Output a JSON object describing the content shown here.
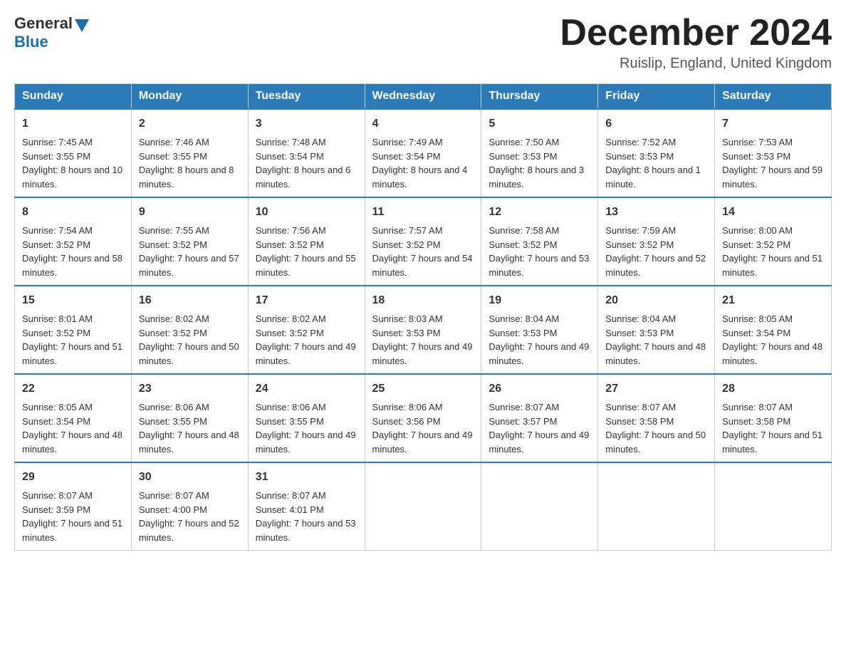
{
  "header": {
    "logo_general": "General",
    "logo_blue": "Blue",
    "month_title": "December 2024",
    "location": "Ruislip, England, United Kingdom"
  },
  "days_of_week": [
    "Sunday",
    "Monday",
    "Tuesday",
    "Wednesday",
    "Thursday",
    "Friday",
    "Saturday"
  ],
  "weeks": [
    [
      {
        "day": "1",
        "sunrise": "7:45 AM",
        "sunset": "3:55 PM",
        "daylight": "8 hours and 10 minutes."
      },
      {
        "day": "2",
        "sunrise": "7:46 AM",
        "sunset": "3:55 PM",
        "daylight": "8 hours and 8 minutes."
      },
      {
        "day": "3",
        "sunrise": "7:48 AM",
        "sunset": "3:54 PM",
        "daylight": "8 hours and 6 minutes."
      },
      {
        "day": "4",
        "sunrise": "7:49 AM",
        "sunset": "3:54 PM",
        "daylight": "8 hours and 4 minutes."
      },
      {
        "day": "5",
        "sunrise": "7:50 AM",
        "sunset": "3:53 PM",
        "daylight": "8 hours and 3 minutes."
      },
      {
        "day": "6",
        "sunrise": "7:52 AM",
        "sunset": "3:53 PM",
        "daylight": "8 hours and 1 minute."
      },
      {
        "day": "7",
        "sunrise": "7:53 AM",
        "sunset": "3:53 PM",
        "daylight": "7 hours and 59 minutes."
      }
    ],
    [
      {
        "day": "8",
        "sunrise": "7:54 AM",
        "sunset": "3:52 PM",
        "daylight": "7 hours and 58 minutes."
      },
      {
        "day": "9",
        "sunrise": "7:55 AM",
        "sunset": "3:52 PM",
        "daylight": "7 hours and 57 minutes."
      },
      {
        "day": "10",
        "sunrise": "7:56 AM",
        "sunset": "3:52 PM",
        "daylight": "7 hours and 55 minutes."
      },
      {
        "day": "11",
        "sunrise": "7:57 AM",
        "sunset": "3:52 PM",
        "daylight": "7 hours and 54 minutes."
      },
      {
        "day": "12",
        "sunrise": "7:58 AM",
        "sunset": "3:52 PM",
        "daylight": "7 hours and 53 minutes."
      },
      {
        "day": "13",
        "sunrise": "7:59 AM",
        "sunset": "3:52 PM",
        "daylight": "7 hours and 52 minutes."
      },
      {
        "day": "14",
        "sunrise": "8:00 AM",
        "sunset": "3:52 PM",
        "daylight": "7 hours and 51 minutes."
      }
    ],
    [
      {
        "day": "15",
        "sunrise": "8:01 AM",
        "sunset": "3:52 PM",
        "daylight": "7 hours and 51 minutes."
      },
      {
        "day": "16",
        "sunrise": "8:02 AM",
        "sunset": "3:52 PM",
        "daylight": "7 hours and 50 minutes."
      },
      {
        "day": "17",
        "sunrise": "8:02 AM",
        "sunset": "3:52 PM",
        "daylight": "7 hours and 49 minutes."
      },
      {
        "day": "18",
        "sunrise": "8:03 AM",
        "sunset": "3:53 PM",
        "daylight": "7 hours and 49 minutes."
      },
      {
        "day": "19",
        "sunrise": "8:04 AM",
        "sunset": "3:53 PM",
        "daylight": "7 hours and 49 minutes."
      },
      {
        "day": "20",
        "sunrise": "8:04 AM",
        "sunset": "3:53 PM",
        "daylight": "7 hours and 48 minutes."
      },
      {
        "day": "21",
        "sunrise": "8:05 AM",
        "sunset": "3:54 PM",
        "daylight": "7 hours and 48 minutes."
      }
    ],
    [
      {
        "day": "22",
        "sunrise": "8:05 AM",
        "sunset": "3:54 PM",
        "daylight": "7 hours and 48 minutes."
      },
      {
        "day": "23",
        "sunrise": "8:06 AM",
        "sunset": "3:55 PM",
        "daylight": "7 hours and 48 minutes."
      },
      {
        "day": "24",
        "sunrise": "8:06 AM",
        "sunset": "3:55 PM",
        "daylight": "7 hours and 49 minutes."
      },
      {
        "day": "25",
        "sunrise": "8:06 AM",
        "sunset": "3:56 PM",
        "daylight": "7 hours and 49 minutes."
      },
      {
        "day": "26",
        "sunrise": "8:07 AM",
        "sunset": "3:57 PM",
        "daylight": "7 hours and 49 minutes."
      },
      {
        "day": "27",
        "sunrise": "8:07 AM",
        "sunset": "3:58 PM",
        "daylight": "7 hours and 50 minutes."
      },
      {
        "day": "28",
        "sunrise": "8:07 AM",
        "sunset": "3:58 PM",
        "daylight": "7 hours and 51 minutes."
      }
    ],
    [
      {
        "day": "29",
        "sunrise": "8:07 AM",
        "sunset": "3:59 PM",
        "daylight": "7 hours and 51 minutes."
      },
      {
        "day": "30",
        "sunrise": "8:07 AM",
        "sunset": "4:00 PM",
        "daylight": "7 hours and 52 minutes."
      },
      {
        "day": "31",
        "sunrise": "8:07 AM",
        "sunset": "4:01 PM",
        "daylight": "7 hours and 53 minutes."
      },
      null,
      null,
      null,
      null
    ]
  ],
  "labels": {
    "sunrise": "Sunrise:",
    "sunset": "Sunset:",
    "daylight": "Daylight:"
  }
}
